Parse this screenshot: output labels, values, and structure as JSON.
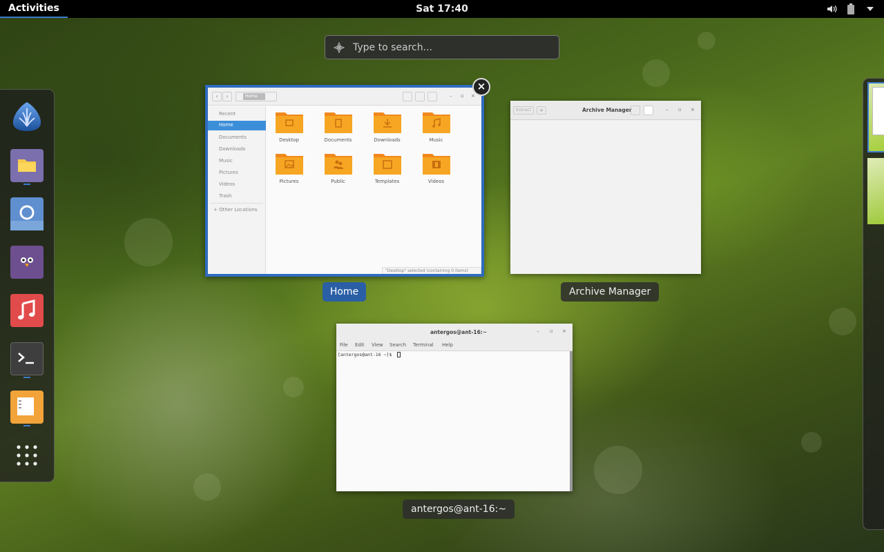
{
  "topbar": {
    "activities": "Activities",
    "clock": "Sat 17:40"
  },
  "search": {
    "placeholder": "Type to search..."
  },
  "dash": {
    "apps": [
      {
        "name": "Antergos",
        "icon": "antergos-logo-icon"
      },
      {
        "name": "Files",
        "icon": "files-folder-icon"
      },
      {
        "name": "Chromium",
        "icon": "chromium-icon"
      },
      {
        "name": "Pidgin",
        "icon": "pidgin-icon"
      },
      {
        "name": "Music",
        "icon": "music-note-icon"
      },
      {
        "name": "Terminal",
        "icon": "terminal-icon"
      },
      {
        "name": "Archive Manager",
        "icon": "archive-icon"
      },
      {
        "name": "Show Applications",
        "icon": "app-grid-icon"
      }
    ]
  },
  "windows": {
    "home": {
      "caption": "Home",
      "path_button": "Home",
      "sidebar": [
        "Recent",
        "Home",
        "Documents",
        "Downloads",
        "Music",
        "Pictures",
        "Videos",
        "Trash",
        "+ Other Locations"
      ],
      "folders": [
        "Desktop",
        "Documents",
        "Downloads",
        "Music",
        "Pictures",
        "Public",
        "Templates",
        "Videos"
      ],
      "status": "\"Desktop\" selected (containing 0 items)"
    },
    "archive": {
      "caption": "Archive Manager",
      "title": "Archive Manager",
      "extract": "Extract",
      "add": "+"
    },
    "terminal": {
      "caption": "antergos@ant-16:~",
      "title": "antergos@ant-16:~",
      "menu": [
        "File",
        "Edit",
        "View",
        "Search",
        "Terminal",
        "Help"
      ],
      "prompt": "[antergos@ant-16 ~]$ "
    }
  },
  "colors": {
    "accent": "#3b7ccf",
    "folder": "#f6a623",
    "selected_caption": "#2a5fa5"
  }
}
